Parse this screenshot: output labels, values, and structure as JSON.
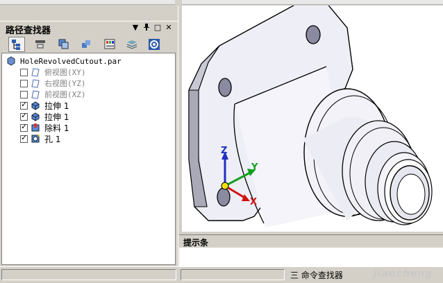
{
  "pane": {
    "title": "路径查找器",
    "controls": [
      "▼",
      "ᵖ",
      "□",
      "✕"
    ]
  },
  "toolbar": {
    "buttons": [
      "path-finder-tab",
      "assembly-tab",
      "layers-tab",
      "features-tab",
      "color-tab",
      "stack-tab",
      "settings-tab"
    ]
  },
  "tree": {
    "file": "HoleRevolvedCutout.par",
    "planes": [
      {
        "label": "俯视图(XY)",
        "checked": false
      },
      {
        "label": "右视图(YZ)",
        "checked": false
      },
      {
        "label": "前视图(XZ)",
        "checked": false
      }
    ],
    "features": [
      {
        "label": "拉伸 1",
        "checked": true,
        "icon": "extrude-icon"
      },
      {
        "label": "拉伸 1",
        "checked": true,
        "icon": "extrude-icon"
      },
      {
        "label": "除料 1",
        "checked": true,
        "icon": "cutout-icon"
      },
      {
        "label": "孔 1",
        "checked": true,
        "icon": "hole-icon"
      }
    ]
  },
  "viewport": {
    "axes": {
      "z": "Z",
      "y": "Y",
      "x": "X"
    }
  },
  "prompt": {
    "title": "提示条"
  },
  "status": {
    "text": "三 命令查找器",
    "watermark": "jiaocheng"
  }
}
